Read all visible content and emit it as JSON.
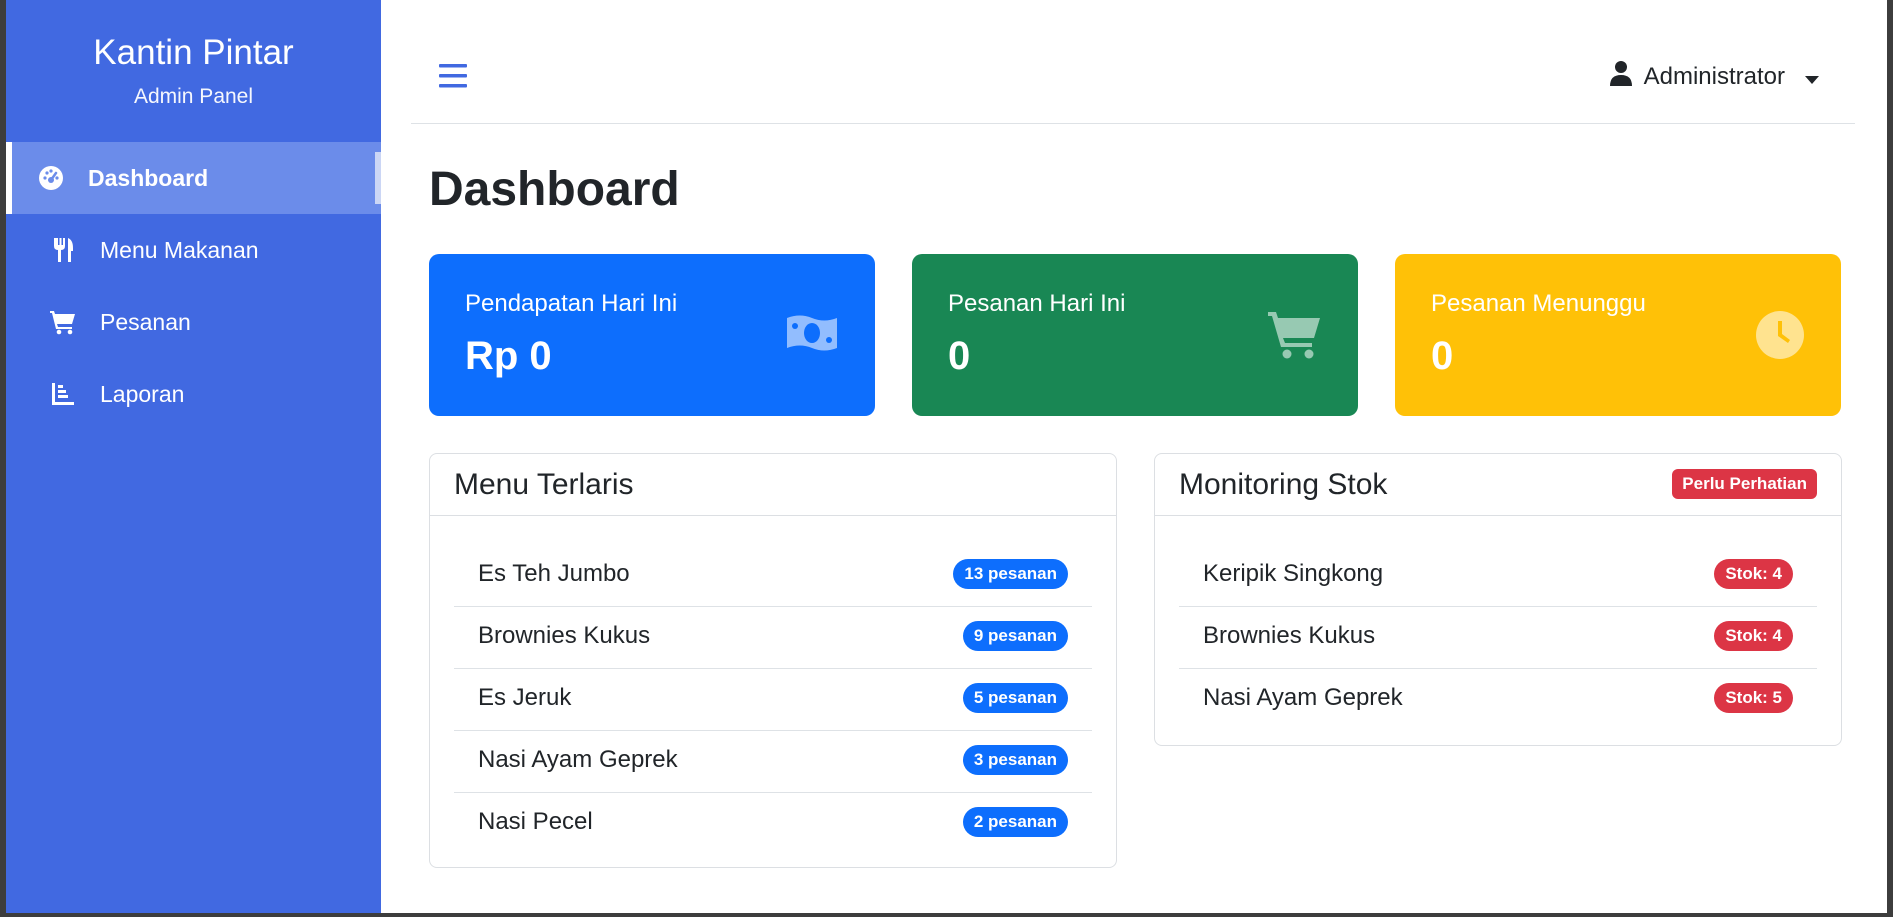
{
  "sidebar": {
    "brand_title": "Kantin Pintar",
    "brand_subtitle": "Admin Panel",
    "items": [
      {
        "label": "Dashboard",
        "icon": "gauge-icon",
        "active": true
      },
      {
        "label": "Menu Makanan",
        "icon": "utensils-icon",
        "active": false
      },
      {
        "label": "Pesanan",
        "icon": "cart-icon",
        "active": false
      },
      {
        "label": "Laporan",
        "icon": "chart-icon",
        "active": false
      }
    ]
  },
  "topbar": {
    "menu_icon": "hamburger-icon",
    "user_icon": "user-icon",
    "user_name": "Administrator"
  },
  "page_title": "Dashboard",
  "stats": [
    {
      "label": "Pendapatan Hari Ini",
      "value": "Rp 0",
      "icon": "money-icon",
      "color": "#0d6efd"
    },
    {
      "label": "Pesanan Hari Ini",
      "value": "0",
      "icon": "cart-icon",
      "color": "#198754"
    },
    {
      "label": "Pesanan Menunggu",
      "value": "0",
      "icon": "clock-icon",
      "color": "#ffc107"
    }
  ],
  "menu_terlaris": {
    "title": "Menu Terlaris",
    "items": [
      {
        "name": "Es Teh Jumbo",
        "badge": "13 pesanan"
      },
      {
        "name": "Brownies Kukus",
        "badge": "9 pesanan"
      },
      {
        "name": "Es Jeruk",
        "badge": "5 pesanan"
      },
      {
        "name": "Nasi Ayam Geprek",
        "badge": "3 pesanan"
      },
      {
        "name": "Nasi Pecel",
        "badge": "2 pesanan"
      }
    ]
  },
  "monitoring_stok": {
    "title": "Monitoring Stok",
    "badge": "Perlu Perhatian",
    "items": [
      {
        "name": "Keripik Singkong",
        "badge": "Stok: 4"
      },
      {
        "name": "Brownies Kukus",
        "badge": "Stok: 4"
      },
      {
        "name": "Nasi Ayam Geprek",
        "badge": "Stok: 5"
      }
    ]
  },
  "colors": {
    "sidebar": "#4169e1",
    "primary": "#0d6efd",
    "success": "#198754",
    "warning": "#ffc107",
    "danger": "#dc3545"
  }
}
